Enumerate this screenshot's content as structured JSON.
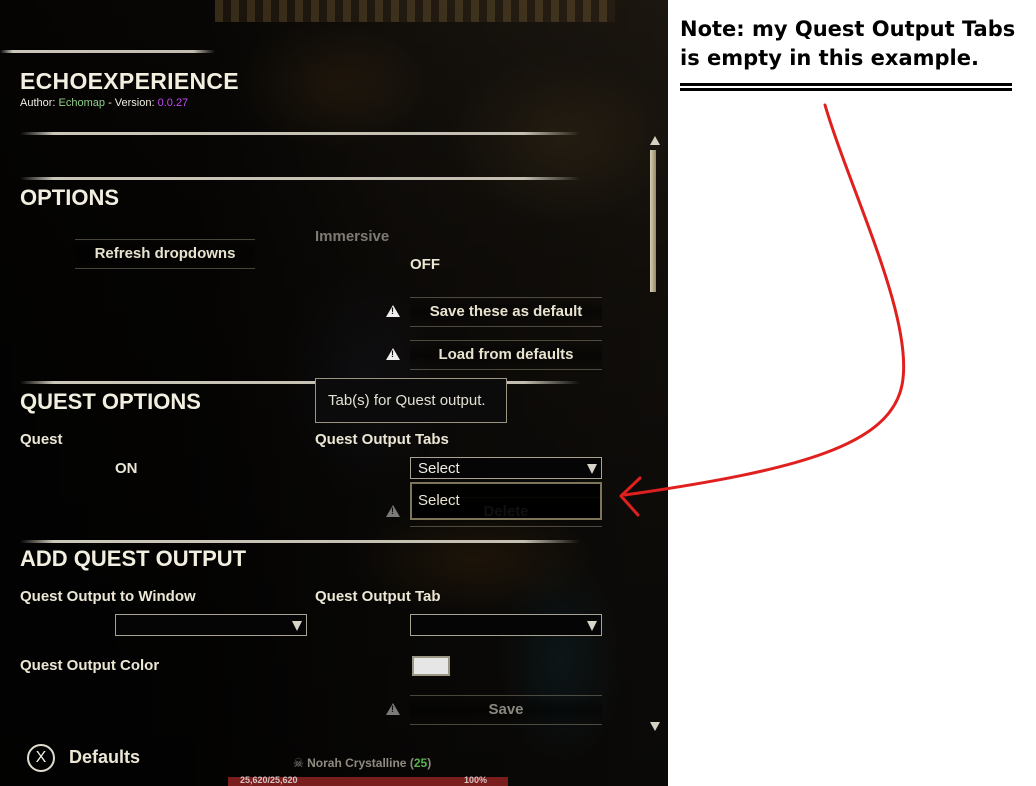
{
  "addon": {
    "title": "ECHOEXPERIENCE",
    "author_prefix": "Author: ",
    "author_name": "Echomap",
    "version_prefix": " - Version: ",
    "version": "0.0.27"
  },
  "options": {
    "heading": "OPTIONS",
    "refresh_button": "Refresh dropdowns",
    "immersive_label": "Immersive",
    "immersive_value": "OFF",
    "save_default_button": "Save these as default",
    "load_default_button": "Load from defaults"
  },
  "quest_options": {
    "heading": "QUEST OPTIONS",
    "quest_label": "Quest",
    "quest_value": "ON",
    "output_tabs_label": "Quest Output Tabs",
    "output_tabs_selected": "Select",
    "output_tabs_open_option": "Select",
    "delete_button": "Delete",
    "tooltip": "Tab(s) for Quest output."
  },
  "add_quest_output": {
    "heading": "ADD QUEST OUTPUT",
    "window_label": "Quest Output to Window",
    "window_value": "",
    "tab_label": "Quest Output Tab",
    "tab_value": "",
    "color_label": "Quest Output Color",
    "color_value": "#e6e6e6",
    "save_button": "Save"
  },
  "footer": {
    "key_glyph": "X",
    "defaults_label": "Defaults"
  },
  "hud": {
    "player_name": "Norah Crystalline",
    "level": "25",
    "health_left": "25,620/25,620",
    "health_right": "100%"
  },
  "annotation": {
    "note_line1": "Note: my Quest Output Tabs",
    "note_line2": "is empty in this example.",
    "arrow_color": "#e0201f"
  },
  "icons": [
    "warning-icon",
    "dropdown-arrow-icon",
    "scroll-up-icon",
    "scroll-down-icon",
    "skull-icon"
  ]
}
